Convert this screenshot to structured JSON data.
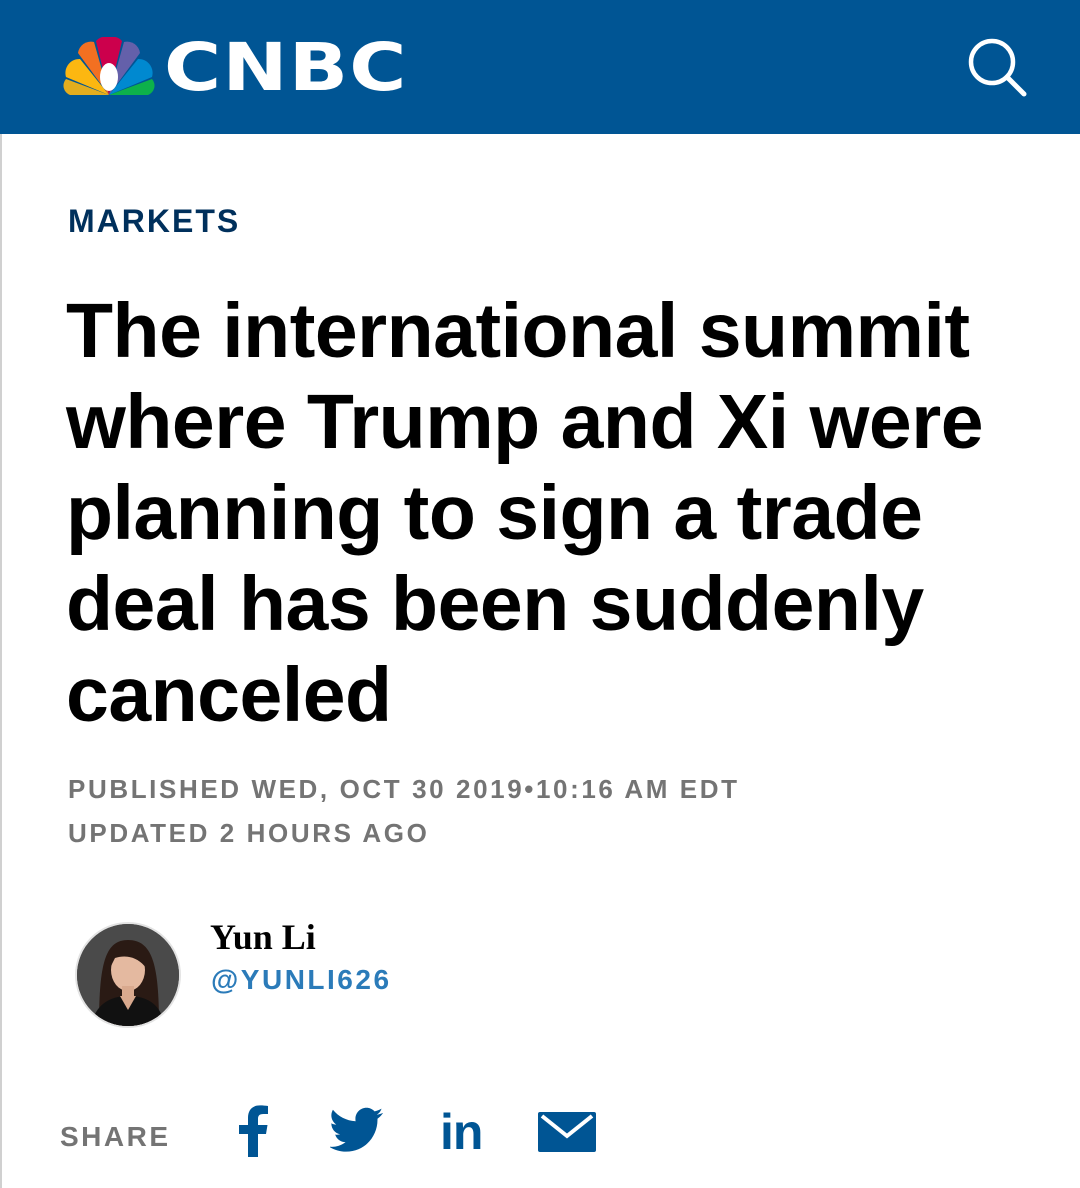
{
  "header": {
    "brand": "CNBC",
    "logo_icon": "nbc-peacock-icon",
    "search_icon": "search-icon",
    "background_color": "#005594"
  },
  "article": {
    "section": "MARKETS",
    "headline": "The international summit where Trump and Xi were planning to sign a trade deal has been suddenly canceled",
    "published": "PUBLISHED WED, OCT 30 2019•10:16 AM EDT",
    "updated": "UPDATED 2 HOURS AGO"
  },
  "author": {
    "name": "Yun Li",
    "handle": "@YUNLI626",
    "avatar_icon": "author-avatar"
  },
  "share": {
    "label": "SHARE",
    "items": [
      {
        "icon": "facebook-icon"
      },
      {
        "icon": "twitter-icon"
      },
      {
        "icon": "linkedin-icon",
        "text": "in"
      },
      {
        "icon": "email-icon"
      }
    ],
    "color": "#005594"
  },
  "colors": {
    "section": "#00305c",
    "meta": "#747474",
    "handle": "#2b7bb9"
  }
}
